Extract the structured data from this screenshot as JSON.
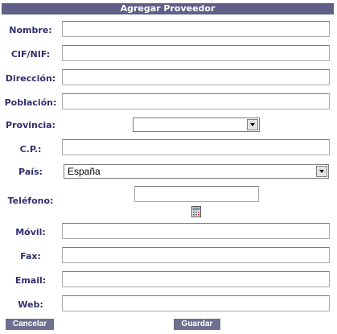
{
  "form": {
    "title": "Agregar Proveedor"
  },
  "fields": {
    "nombre": {
      "label": "Nombre:",
      "value": ""
    },
    "cif": {
      "label": "CIF/NIF:",
      "value": ""
    },
    "direccion": {
      "label": "Dirección:",
      "value": ""
    },
    "poblacion": {
      "label": "Población:",
      "value": ""
    },
    "provincia": {
      "label": "Provincia:",
      "selected": ""
    },
    "cp": {
      "label": "C.P.:",
      "value": ""
    },
    "pais": {
      "label": "País:",
      "selected": "España"
    },
    "telefono": {
      "label": "Teléfono:",
      "value": ""
    },
    "movil": {
      "label": "Móvil:",
      "value": ""
    },
    "fax": {
      "label": "Fax:",
      "value": ""
    },
    "email": {
      "label": "Email:",
      "value": ""
    },
    "web": {
      "label": "Web:",
      "value": ""
    }
  },
  "icons": {
    "telefono_helper": "calculator-icon"
  },
  "buttons": {
    "cancel": "Cancelar",
    "save": "Guardar"
  },
  "colors": {
    "header_bg": "#5f5f87",
    "label_text": "#2f2f6f",
    "button_bg": "#6f6f8f"
  }
}
